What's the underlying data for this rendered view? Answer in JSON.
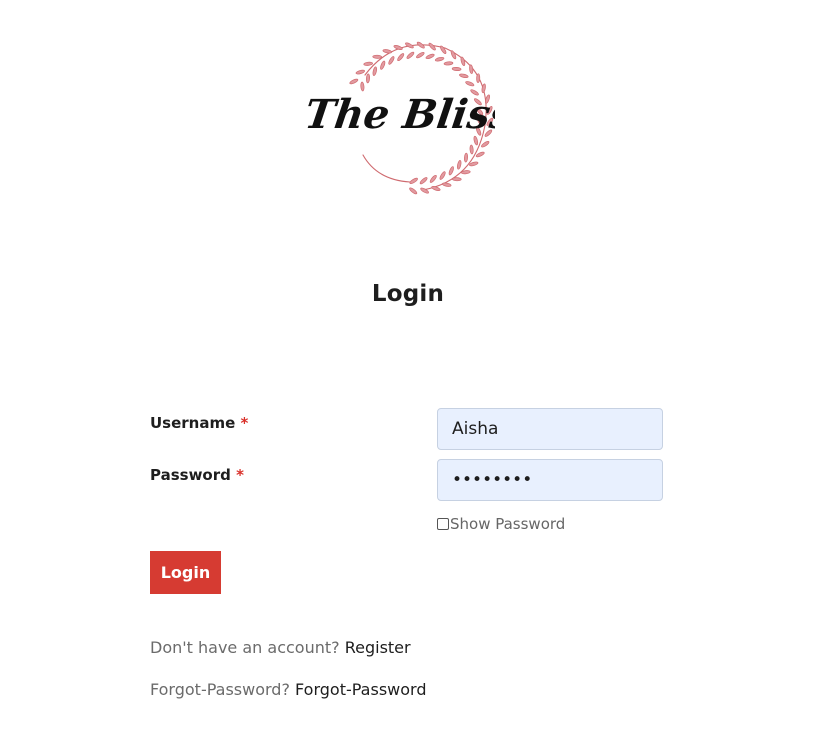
{
  "brand": {
    "logo_text": "The Bliss",
    "wreath_color": "#cf6a6f"
  },
  "page": {
    "title": "Login"
  },
  "form": {
    "username_label": "Username",
    "password_label": "Password",
    "required_marker": "*",
    "username_value": "Aisha",
    "password_value": "••••••••",
    "show_password_label": "Show Password",
    "show_password_checked": false,
    "submit_label": "Login"
  },
  "links": {
    "register_prompt": "Don't have an account?",
    "register_label": "Register",
    "forgot_prompt": "Forgot-Password?",
    "forgot_label": "Forgot-Password"
  },
  "colors": {
    "accent": "#d63b32",
    "required": "#d9302a",
    "input_fill": "#e8f0fe"
  }
}
